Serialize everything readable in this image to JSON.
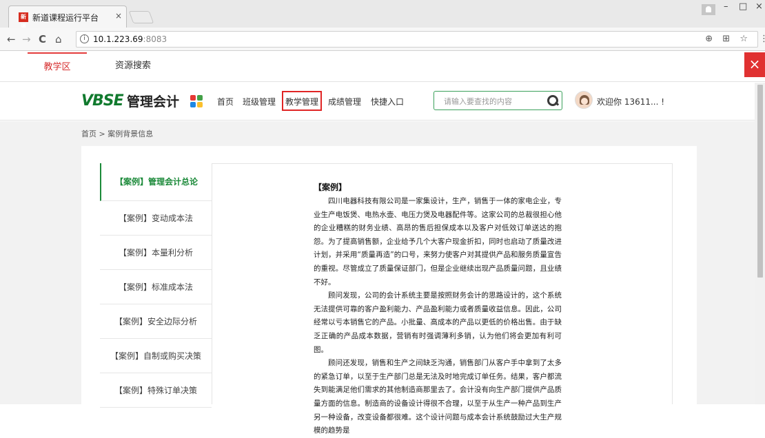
{
  "browser": {
    "tab_title": "新道课程运行平台",
    "tab_close": "×",
    "favicon_text": "新道",
    "url_host": "10.1.223.69",
    "url_port": ":8083",
    "back": "←",
    "forward": "→",
    "reload": "C",
    "home": "⌂",
    "info": "i",
    "zoom_icon": "⊕",
    "translate_icon": "⊞",
    "star_icon": "☆",
    "menu_icon": "⋮",
    "win_minimize": "–",
    "win_maximize": "□",
    "win_close": "×"
  },
  "topnav": {
    "items": [
      {
        "label": "教学区",
        "active": true
      },
      {
        "label": "资源搜索",
        "active": false
      }
    ],
    "close_label": "×"
  },
  "header": {
    "logo": "VBSE",
    "logo_sub": "管理会计",
    "menu": [
      "首页",
      "班级管理",
      "教学管理",
      "成绩管理",
      "快捷入口"
    ],
    "highlighted_menu": "教学管理",
    "search_placeholder": "请输入要查找的内容",
    "welcome": "欢迎你 13611... !",
    "grid_colors": [
      "#e53935",
      "#43a047",
      "#1e88e5",
      "#fbc02d"
    ]
  },
  "breadcrumb": "首页 > 案例背景信息",
  "sidebar": {
    "items": [
      "【案例】管理会计总论",
      "【案例】变动成本法",
      "【案例】本量利分析",
      "【案例】标准成本法",
      "【案例】安全边际分析",
      "【案例】自制或购买决策",
      "【案例】特殊订单决策"
    ]
  },
  "content": {
    "title": "【案例】",
    "paragraphs": [
      "四川电器科技有限公司是一家集设计，生产，销售于一体的家电企业，专业生产电饭煲、电热水壶、电压力煲及电器配件等。这家公司的总裁很担心他的企业糟糕的财务业绩、高昂的售后担保成本以及客户对低效订单送达的抱怨。为了提高销售额，企业给予几个大客户现金折扣，同时也启动了质量改进计划，并采用“质量再造”的口号，来努力使客户对其提供产品和服务质量宣告的重视。尽管成立了质量保证部门，但是企业继续出现产品质量问题，且业绩不好。",
      "顾问发现，公司的会计系统主要是按照财务会计的思路设计的，这个系统无法提供可靠的客户盈利能力、产品盈利能力或者质量收益信息。因此，公司经常以亏本销售它的产品。小批量、高成本的产品以更低的价格出售。由于缺乏正确的产品成本数据，营销有时强调薄利多销，认为他们将会更加有利可图。",
      "顾问还发现，销售和生产之间缺乏沟通，销售部门从客户手中拿到了太多的紧急订单，以至于生产部门总是无法及时地完成订单任务。结果，客户都流失到能满足他们需求的其他制造商那里去了。会计没有向生产部门提供产品质量方面的信息。制造商的设备设计得很不合理，以至于从生产一种产品到生产另一种设备，改变设备都很难。这个设计问题与成本会计系统鼓励过大生产规模的趋势是"
    ]
  }
}
